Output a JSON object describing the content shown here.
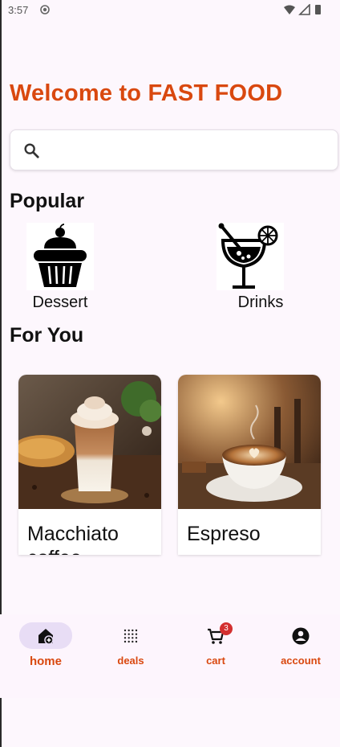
{
  "status_bar": {
    "time": "3:57"
  },
  "header": {
    "welcome": "Welcome to FAST FOOD"
  },
  "search": {
    "placeholder": "",
    "value": ""
  },
  "popular": {
    "title": "Popular",
    "items": [
      {
        "label": "Dessert",
        "icon": "cupcake-icon"
      },
      {
        "label": "Drinks",
        "icon": "cocktail-icon"
      }
    ]
  },
  "for_you": {
    "title": "For You",
    "items": [
      {
        "label": "Macchiato coffee"
      },
      {
        "label": "Espreso"
      }
    ]
  },
  "nav": {
    "items": [
      {
        "label": "home",
        "icon": "home-icon",
        "active": true
      },
      {
        "label": "deals",
        "icon": "deals-icon"
      },
      {
        "label": "cart",
        "icon": "cart-icon",
        "badge": "3"
      },
      {
        "label": "account",
        "icon": "account-icon"
      }
    ]
  },
  "colors": {
    "accent": "#d9480f",
    "background": "#fdf7fd",
    "nav_active_pill": "#e8ddf5",
    "badge": "#d32f2f"
  }
}
